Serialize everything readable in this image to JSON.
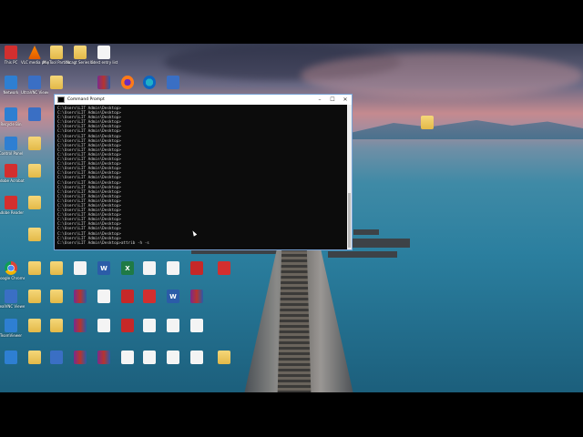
{
  "cmd": {
    "title": "Command Prompt",
    "minimize": "–",
    "maximize": "☐",
    "close": "✕",
    "lines": [
      "C:\\Users\\LIT Admin\\Desktop>",
      "C:\\Users\\LIT Admin\\Desktop>",
      "C:\\Users\\LIT Admin\\Desktop>",
      "C:\\Users\\LIT Admin\\Desktop>",
      "C:\\Users\\LIT Admin\\Desktop>",
      "C:\\Users\\LIT Admin\\Desktop>",
      "C:\\Users\\LIT Admin\\Desktop>",
      "C:\\Users\\LIT Admin\\Desktop>",
      "C:\\Users\\LIT Admin\\Desktop>",
      "C:\\Users\\LIT Admin\\Desktop>",
      "C:\\Users\\LIT Admin\\Desktop>",
      "C:\\Users\\LIT Admin\\Desktop>",
      "C:\\Users\\LIT Admin\\Desktop>",
      "C:\\Users\\LIT Admin\\Desktop>",
      "C:\\Users\\LIT Admin\\Desktop>",
      "C:\\Users\\LIT Admin\\Desktop>",
      "C:\\Users\\LIT Admin\\Desktop>",
      "C:\\Users\\LIT Admin\\Desktop>",
      "C:\\Users\\LIT Admin\\Desktop>",
      "C:\\Users\\LIT Admin\\Desktop>",
      "C:\\Users\\LIT Admin\\Desktop>",
      "C:\\Users\\LIT Admin\\Desktop>",
      "C:\\Users\\LIT Admin\\Desktop>",
      "C:\\Users\\LIT Admin\\Desktop>",
      "C:\\Users\\LIT Admin\\Desktop>",
      "C:\\Users\\LIT Admin\\Desktop>",
      "C:\\Users\\LIT Admin\\Desktop>",
      "C:\\Users\\LIT Admin\\Desktop>",
      "C:\\Users\\LIT Admin\\Desktop>",
      "C:\\Users\\LIT Admin\\Desktop>attrib -h -s"
    ]
  },
  "icons": [
    {
      "label": "This PC",
      "kind": "g-blue",
      "glyph": ""
    },
    {
      "label": "VLC media player",
      "kind": "g-vlc",
      "glyph": ""
    },
    {
      "label": "MinTool Partition W.",
      "kind": "g-folder",
      "glyph": ""
    },
    {
      "label": "Ncagt Series Configurat",
      "kind": "g-folder",
      "glyph": ""
    },
    {
      "label": "latest entry list",
      "kind": "g-doc",
      "glyph": ""
    },
    {
      "label": "Network",
      "kind": "g-blue",
      "glyph": ""
    },
    {
      "label": "UltraVNC Viewer",
      "kind": "g-app",
      "glyph": ""
    },
    {
      "label": "",
      "kind": "g-folder",
      "glyph": ""
    },
    {
      "label": "",
      "kind": "g-rar",
      "glyph": ""
    },
    {
      "label": "",
      "kind": "g-firefox",
      "glyph": ""
    },
    {
      "label": "",
      "kind": "g-edge",
      "glyph": ""
    },
    {
      "label": "",
      "kind": "g-app",
      "glyph": ""
    },
    {
      "label": "Recycle Bin",
      "kind": "g-blue",
      "glyph": ""
    },
    {
      "label": "",
      "kind": "g-app",
      "glyph": ""
    },
    {
      "label": "Control Panel",
      "kind": "g-blue",
      "glyph": ""
    },
    {
      "label": "",
      "kind": "g-folder",
      "glyph": ""
    },
    {
      "label": "Adobe Acrobat",
      "kind": "g-pdf",
      "glyph": ""
    },
    {
      "label": "",
      "kind": "g-folder",
      "glyph": ""
    },
    {
      "label": "Adobe Reader",
      "kind": "g-pdf",
      "glyph": ""
    },
    {
      "label": "",
      "kind": "g-folder",
      "glyph": ""
    },
    {
      "label": "",
      "kind": "g-folder",
      "glyph": ""
    },
    {
      "label": "Google Chrome",
      "kind": "g-chrome",
      "glyph": ""
    },
    {
      "label": "",
      "kind": "g-folder",
      "glyph": ""
    },
    {
      "label": "",
      "kind": "g-folder",
      "glyph": ""
    },
    {
      "label": "",
      "kind": "g-doc",
      "glyph": ""
    },
    {
      "label": "",
      "kind": "g-word",
      "glyph": "W"
    },
    {
      "label": "",
      "kind": "g-excel",
      "glyph": "X"
    },
    {
      "label": "",
      "kind": "g-doc",
      "glyph": ""
    },
    {
      "label": "",
      "kind": "g-doc",
      "glyph": ""
    },
    {
      "label": "",
      "kind": "g-red",
      "glyph": ""
    },
    {
      "label": "",
      "kind": "g-pdf",
      "glyph": ""
    },
    {
      "label": "RealVNC Viewer",
      "kind": "g-app",
      "glyph": ""
    },
    {
      "label": "",
      "kind": "g-folder",
      "glyph": ""
    },
    {
      "label": "",
      "kind": "g-folder",
      "glyph": ""
    },
    {
      "label": "",
      "kind": "g-rar",
      "glyph": ""
    },
    {
      "label": "",
      "kind": "g-doc",
      "glyph": ""
    },
    {
      "label": "",
      "kind": "g-red",
      "glyph": ""
    },
    {
      "label": "",
      "kind": "g-pdf",
      "glyph": ""
    },
    {
      "label": "",
      "kind": "g-word",
      "glyph": "W"
    },
    {
      "label": "",
      "kind": "g-rar",
      "glyph": ""
    },
    {
      "label": "TeamViewer",
      "kind": "g-blue",
      "glyph": ""
    },
    {
      "label": "",
      "kind": "g-folder",
      "glyph": ""
    },
    {
      "label": "",
      "kind": "g-folder",
      "glyph": ""
    },
    {
      "label": "",
      "kind": "g-rar",
      "glyph": ""
    },
    {
      "label": "",
      "kind": "g-doc",
      "glyph": ""
    },
    {
      "label": "",
      "kind": "g-red",
      "glyph": ""
    },
    {
      "label": "",
      "kind": "g-doc",
      "glyph": ""
    },
    {
      "label": "",
      "kind": "g-doc",
      "glyph": ""
    },
    {
      "label": "",
      "kind": "g-doc",
      "glyph": ""
    },
    {
      "label": "",
      "kind": "g-blue",
      "glyph": ""
    },
    {
      "label": "",
      "kind": "g-folder",
      "glyph": ""
    },
    {
      "label": "",
      "kind": "g-app",
      "glyph": ""
    },
    {
      "label": "",
      "kind": "g-rar",
      "glyph": ""
    },
    {
      "label": "",
      "kind": "g-rar",
      "glyph": ""
    },
    {
      "label": "",
      "kind": "g-doc",
      "glyph": ""
    },
    {
      "label": "",
      "kind": "g-doc",
      "glyph": ""
    },
    {
      "label": "",
      "kind": "g-doc",
      "glyph": ""
    },
    {
      "label": "",
      "kind": "g-doc",
      "glyph": ""
    },
    {
      "label": "",
      "kind": "g-folder",
      "glyph": ""
    },
    {
      "label": "",
      "kind": "g-pdf",
      "glyph": ""
    }
  ]
}
